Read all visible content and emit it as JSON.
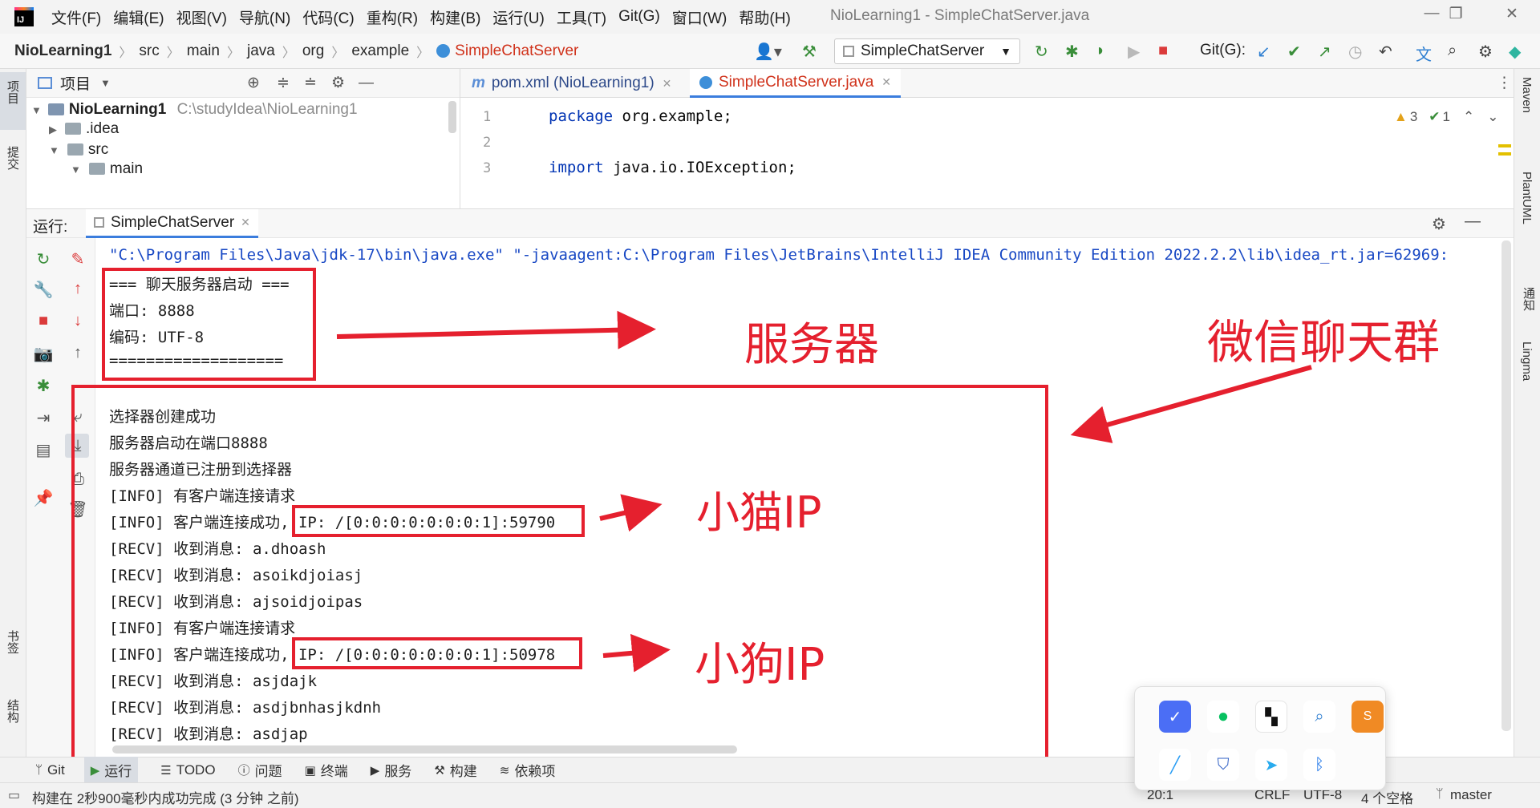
{
  "menubar": {
    "items": [
      "文件(F)",
      "编辑(E)",
      "视图(V)",
      "导航(N)",
      "代码(C)",
      "重构(R)",
      "构建(B)",
      "运行(U)",
      "工具(T)",
      "Git(G)",
      "窗口(W)",
      "帮助(H)"
    ],
    "window_title": "NioLearning1 - SimpleChatServer.java"
  },
  "breadcrumb": [
    "NioLearning1",
    "src",
    "main",
    "java",
    "org",
    "example",
    "SimpleChatServer"
  ],
  "toolbar": {
    "run_config": "SimpleChatServer",
    "git_label": "Git(G):"
  },
  "left_strip": {
    "project": "项目",
    "commit": "提交",
    "bookmarks": "书签",
    "structure": "结构"
  },
  "right_strip": {
    "maven": "Maven",
    "plantuml": "PlantUML",
    "notifications": "通知",
    "lingma": "Lingma"
  },
  "project_panel": {
    "title": "项目",
    "root_name": "NioLearning1",
    "root_path": "C:\\studyIdea\\NioLearning1",
    "items": [
      ".idea",
      "src",
      "main"
    ]
  },
  "editor": {
    "tabs": [
      "pom.xml (NioLearning1)",
      "SimpleChatServer.java"
    ],
    "warnings": "3",
    "checks": "1",
    "line_numbers": [
      "1",
      "2",
      "3"
    ],
    "line1": {
      "kw": "package",
      "rest": " org.example;"
    },
    "line3": {
      "kw": "import",
      "rest": " java.io.IOException;"
    }
  },
  "run_panel": {
    "label": "运行:",
    "tab": "SimpleChatServer",
    "command": "\"C:\\Program Files\\Java\\jdk-17\\bin\\java.exe\" \"-javaagent:C:\\Program Files\\JetBrains\\IntelliJ IDEA Community Edition 2022.2.2\\lib\\idea_rt.jar=62969:",
    "lines": [
      "=== 聊天服务器启动 ===",
      "端口: 8888",
      "编码: UTF-8",
      "===================",
      "",
      "选择器创建成功",
      "服务器启动在端口8888",
      "服务器通道已注册到选择器",
      "[INFO] 有客户端连接请求",
      "[INFO] 客户端连接成功, IP: /[0:0:0:0:0:0:0:1]:59790",
      "[RECV] 收到消息: a.dhoash",
      "[RECV] 收到消息: asoikdjoiasj",
      "[RECV] 收到消息: ajsoidjoipas",
      "[INFO] 有客户端连接请求",
      "[INFO] 客户端连接成功, IP: /[0:0:0:0:0:0:0:1]:50978",
      "[RECV] 收到消息: asjdajk",
      "[RECV] 收到消息: asdjbnhasjkdnh",
      "[RECV] 收到消息: asdjap"
    ]
  },
  "annotations": {
    "server": "服务器",
    "group": "微信聊天群",
    "cat": "小猫IP",
    "dog": "小狗IP"
  },
  "bottom_tabs": [
    "Git",
    "运行",
    "TODO",
    "问题",
    "终端",
    "服务",
    "构建",
    "依赖项"
  ],
  "status": {
    "message": "构建在 2秒900毫秒内成功完成 (3 分钟 之前)",
    "position": "20:1",
    "line_sep": "CRLF",
    "encoding": "UTF-8",
    "indent": "4 个空格",
    "branch": "master"
  },
  "colors": {
    "annotation_red": "#e5202e",
    "keyword_blue": "#0033b3",
    "cmd_blue": "#1848c4"
  }
}
